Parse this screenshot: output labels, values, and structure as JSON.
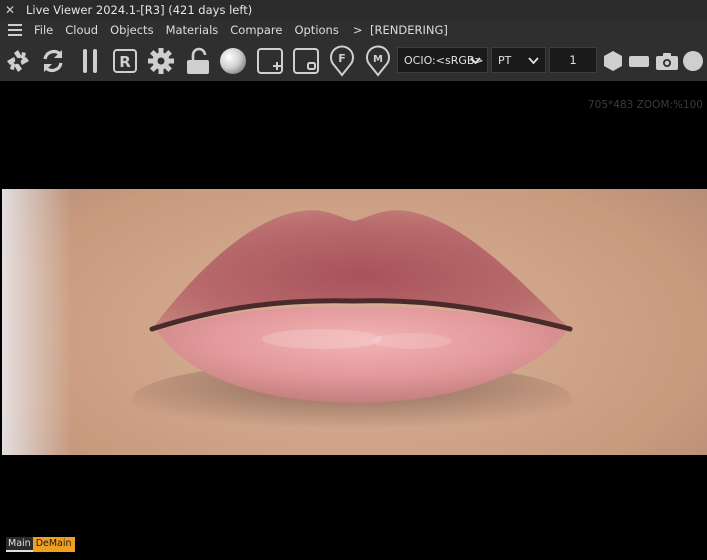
{
  "window": {
    "title": "Live Viewer 2024.1-[R3] (421 days left)",
    "close_glyph": "✕"
  },
  "menu": {
    "items": [
      "File",
      "Cloud",
      "Objects",
      "Materials",
      "Compare",
      "Options"
    ],
    "more": ">",
    "status": "[RENDERING]"
  },
  "toolbar": {
    "icons": [
      "aperture-icon",
      "refresh-icon",
      "pause-icon",
      "region-r-icon",
      "settings-gear-icon",
      "unlock-icon",
      "sphere-icon",
      "add-object-icon",
      "remove-object-icon",
      "pin-f-icon",
      "pin-m-icon",
      "hexagon-icon",
      "rectangle-icon",
      "camera-icon",
      "circle-icon"
    ],
    "ocio": {
      "value": "OCIO:<sRGB>"
    },
    "kernel": {
      "value": "PT"
    },
    "samples": {
      "value": "1"
    }
  },
  "viewport": {
    "zoom_info": "705*483 ZOOM:%100"
  },
  "tabs": {
    "main": "Main",
    "demain": "DeMain"
  },
  "colors": {
    "chrome": "#2f2f2f",
    "accent_tab": "#f0a020",
    "icon": "#cfcfcf"
  }
}
